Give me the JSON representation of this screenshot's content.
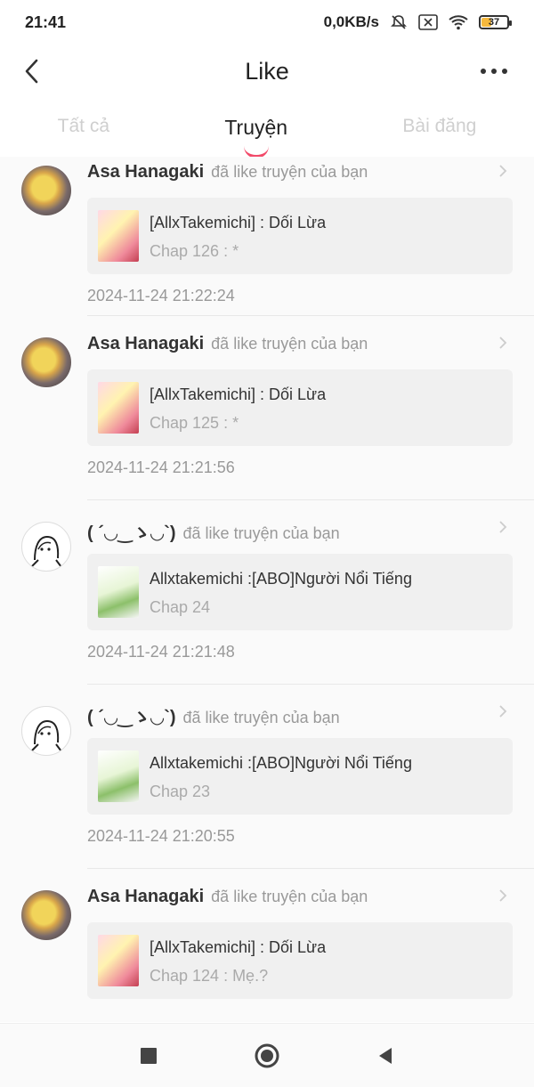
{
  "status": {
    "time": "21:41",
    "speed": "0,0KB/s",
    "battery": "37",
    "battery_level": 0.37
  },
  "header": {
    "title": "Like"
  },
  "tabs": [
    {
      "label": "Tất cả"
    },
    {
      "label": "Truyện"
    },
    {
      "label": "Bài đăng"
    }
  ],
  "items": [
    {
      "user": "Asa Hanagaki",
      "action": "đã like truyện của bạn",
      "title": "[AllxTakemichi] : Dối Lừa",
      "chapter": "Chap 126 : *",
      "time": "2024-11-24 21:22:24"
    },
    {
      "user": "Asa Hanagaki",
      "action": "đã like truyện của bạn",
      "title": "[AllxTakemichi] : Dối Lừa",
      "chapter": "Chap 125 : *",
      "time": "2024-11-24 21:21:56"
    },
    {
      "user": "( ´◡‿ゝ◡`)",
      "action": "đã like truyện của bạn",
      "title": "Allxtakemichi :[ABO]Người Nổi Tiếng",
      "chapter": "Chap 24",
      "time": "2024-11-24 21:21:48"
    },
    {
      "user": "( ´◡‿ゝ◡`)",
      "action": "đã like truyện của bạn",
      "title": "Allxtakemichi :[ABO]Người Nổi Tiếng",
      "chapter": "Chap 23",
      "time": "2024-11-24 21:20:55"
    },
    {
      "user": "Asa Hanagaki",
      "action": "đã like truyện của bạn",
      "title": "[AllxTakemichi] : Dối Lừa",
      "chapter": "Chap 124 : Mẹ.?",
      "time": ""
    }
  ],
  "colors": {
    "accent": "#f24b6a",
    "card": "#f0f0f0"
  }
}
